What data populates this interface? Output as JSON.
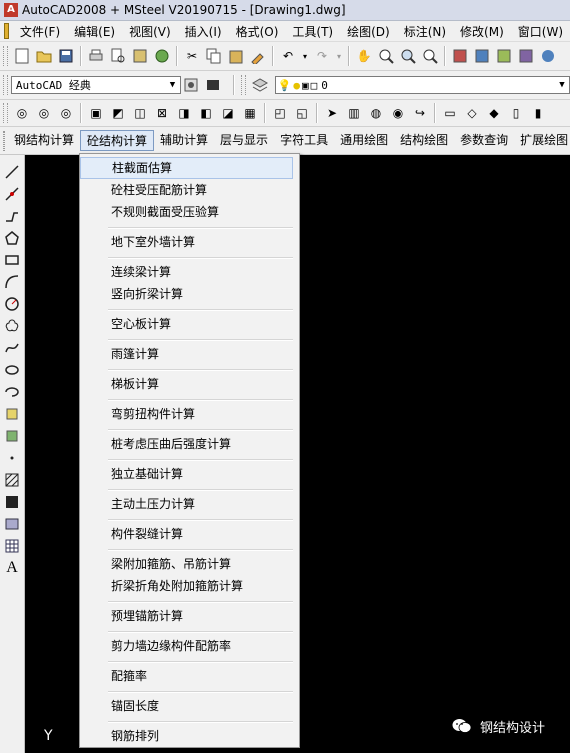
{
  "window": {
    "title": "AutoCAD2008 + MSteel V20190715 - [Drawing1.dwg]"
  },
  "menubar": {
    "items": [
      "文件(F)",
      "编辑(E)",
      "视图(V)",
      "插入(I)",
      "格式(O)",
      "工具(T)",
      "绘图(D)",
      "标注(N)",
      "修改(M)",
      "窗口(W)"
    ]
  },
  "workspace": {
    "value": "AutoCAD 经典"
  },
  "layer": {
    "value": "0"
  },
  "ribbon_tabs": [
    "钢结构计算",
    "砼结构计算",
    "辅助计算",
    "层与显示",
    "字符工具",
    "通用绘图",
    "结构绘图",
    "参数查询",
    "扩展绘图"
  ],
  "active_tab": "砼结构计算",
  "dropdown": {
    "items": [
      "柱截面估算",
      "砼柱受压配筋计算",
      "不规则截面受压验算",
      "地下室外墙计算",
      "连续梁计算",
      "竖向折梁计算",
      "空心板计算",
      "雨篷计算",
      "梯板计算",
      "弯剪扭构件计算",
      "桩考虑压曲后强度计算",
      "独立基础计算",
      "主动土压力计算",
      "构件裂缝计算",
      "梁附加箍筋、吊筋计算",
      "折梁折角处附加箍筋计算",
      "预埋锚筋计算",
      "剪力墙边缘构件配筋率",
      "配箍率",
      "锚固长度",
      "钢筋排列"
    ]
  },
  "canvas": {
    "ucs_label": "Y"
  },
  "watermark": {
    "text": "钢结构设计"
  },
  "colors": {
    "titlebar": "#d6dbe9",
    "menu_bg": "#f2f2f2",
    "highlight": "#e3edf9",
    "canvas": "#000000"
  }
}
